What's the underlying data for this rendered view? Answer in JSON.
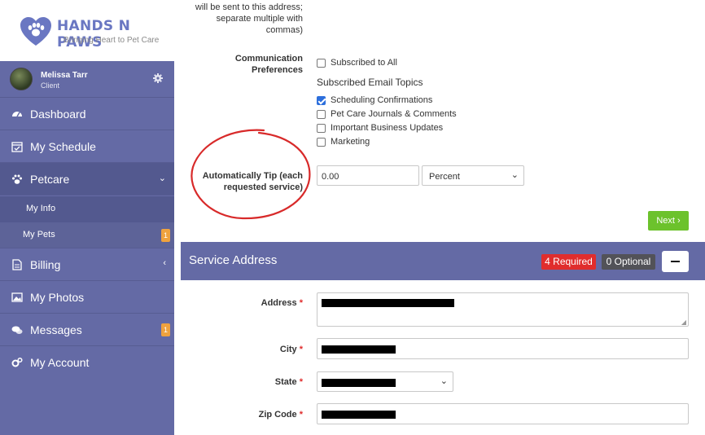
{
  "brand": {
    "title": "HANDS N PAWS",
    "tagline": "Bringing Heart to Pet Care"
  },
  "user": {
    "name": "Melissa Tarr",
    "role": "Client"
  },
  "nav": {
    "dashboard": "Dashboard",
    "schedule": "My Schedule",
    "petcare": "Petcare",
    "my_info": "My Info",
    "my_pets": "My Pets",
    "my_pets_badge": "1",
    "billing": "Billing",
    "photos": "My Photos",
    "messages": "Messages",
    "messages_badge": "1",
    "account": "My Account"
  },
  "form": {
    "email_note": [
      "will be sent to this address;",
      "separate multiple with",
      "commas)"
    ],
    "comm_label": [
      "Communication",
      "Preferences"
    ],
    "subscribed_all": "Subscribed to All",
    "topics_heading": "Subscribed Email Topics",
    "topics": [
      {
        "label": "Scheduling Confirmations",
        "checked": true
      },
      {
        "label": "Pet Care Journals & Comments",
        "checked": false
      },
      {
        "label": "Important Business Updates",
        "checked": false
      },
      {
        "label": "Marketing",
        "checked": false
      }
    ],
    "tip_label": [
      "Automatically Tip (each",
      "requested service)"
    ],
    "tip_value": "0.00",
    "tip_unit": "Percent",
    "next_label": "Next ›"
  },
  "service_address": {
    "title": "Service Address",
    "required": "4 Required",
    "optional": "0 Optional",
    "address_label": "Address",
    "city_label": "City",
    "state_label": "State",
    "zip_label": "Zip Code",
    "required_mark": "*"
  },
  "colors": {
    "sidebar": "#646aa5",
    "accent_green": "#6cc22c",
    "required_red": "#e02d2d",
    "brand_purple": "#6a77c2"
  }
}
